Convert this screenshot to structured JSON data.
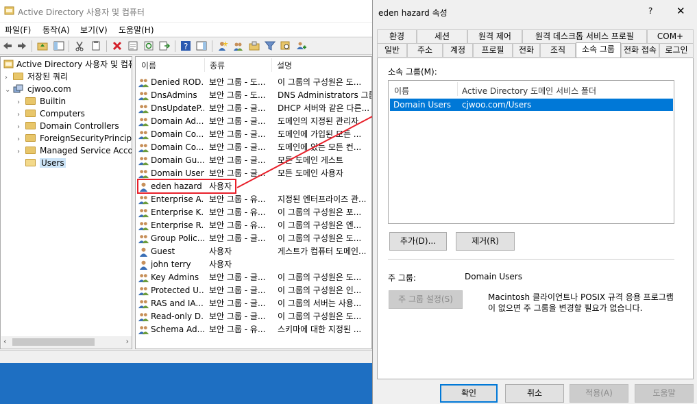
{
  "mmc": {
    "title": "Active Directory 사용자 및 컴퓨터",
    "menu": [
      "파일(F)",
      "동작(A)",
      "보기(V)",
      "도움말(H)"
    ],
    "tree": {
      "root": "Active Directory 사용자 및 컴퓨",
      "saved_queries": "저장된 쿼리",
      "domain": "cjwoo.com",
      "children": [
        "Builtin",
        "Computers",
        "Domain Controllers",
        "ForeignSecurityPrincipal",
        "Managed Service Accou",
        "Users"
      ],
      "selected": "Users"
    },
    "list": {
      "columns": [
        "이름",
        "종류",
        "설명"
      ],
      "rows": [
        {
          "name": "Denied ROD...",
          "type": "보안 그룹 - 도...",
          "desc": "이 그룹의 구성원은 도...",
          "icon": "group-icon"
        },
        {
          "name": "DnsAdmins",
          "type": "보안 그룹 - 도...",
          "desc": "DNS Administrators 그룹",
          "icon": "group-icon"
        },
        {
          "name": "DnsUpdateP...",
          "type": "보안 그룹 - 글...",
          "desc": "DHCP 서버와 같은 다른...",
          "icon": "group-icon"
        },
        {
          "name": "Domain Ad...",
          "type": "보안 그룹 - 글...",
          "desc": "도메인의 지정된 관리자",
          "icon": "group-icon"
        },
        {
          "name": "Domain Co...",
          "type": "보안 그룹 - 글...",
          "desc": "도메인에 가입된 모든 ...",
          "icon": "group-icon"
        },
        {
          "name": "Domain Co...",
          "type": "보안 그룹 - 글...",
          "desc": "도메인에 있는 모든 컨...",
          "icon": "group-icon"
        },
        {
          "name": "Domain Gu...",
          "type": "보안 그룹 - 글...",
          "desc": "모든 도메인 게스트",
          "icon": "group-icon"
        },
        {
          "name": "Domain Users",
          "type": "보안 그룹 - 글...",
          "desc": "모든 도메인 사용자",
          "icon": "group-icon"
        },
        {
          "name": "eden hazard",
          "type": "사용자",
          "desc": "",
          "icon": "user-icon"
        },
        {
          "name": "Enterprise A...",
          "type": "보안 그룹 - 유...",
          "desc": "지정된 엔터프라이즈 관...",
          "icon": "group-icon"
        },
        {
          "name": "Enterprise K...",
          "type": "보안 그룹 - 유...",
          "desc": "이 그룹의 구성원은 포...",
          "icon": "group-icon"
        },
        {
          "name": "Enterprise R...",
          "type": "보안 그룹 - 유...",
          "desc": "이 그룹의 구성원은 엔...",
          "icon": "group-icon"
        },
        {
          "name": "Group Polic...",
          "type": "보안 그룹 - 글...",
          "desc": "이 그룹의 구성원은 도...",
          "icon": "group-icon"
        },
        {
          "name": "Guest",
          "type": "사용자",
          "desc": "게스트가 컴퓨터 도메인...",
          "icon": "user-icon"
        },
        {
          "name": "john terry",
          "type": "사용자",
          "desc": "",
          "icon": "user-icon"
        },
        {
          "name": "Key Admins",
          "type": "보안 그룹 - 글...",
          "desc": "이 그룹의 구성원은 도...",
          "icon": "group-icon"
        },
        {
          "name": "Protected U...",
          "type": "보안 그룹 - 글...",
          "desc": "이 그룹의 구성원은 인...",
          "icon": "group-icon"
        },
        {
          "name": "RAS and IA...",
          "type": "보안 그룹 - 글...",
          "desc": "이 그룹의 서버는 사용...",
          "icon": "group-icon"
        },
        {
          "name": "Read-only D...",
          "type": "보안 그룹 - 글...",
          "desc": "이 그룹의 구성원은 도...",
          "icon": "group-icon"
        },
        {
          "name": "Schema Ad...",
          "type": "보안 그룹 - 유...",
          "desc": "스키마에 대한 지정된 ...",
          "icon": "group-icon"
        }
      ]
    }
  },
  "dialog": {
    "title": "eden hazard 속성",
    "help": "?",
    "close": "✕",
    "tabs_row1": [
      "환경",
      "세션",
      "원격 제어",
      "원격 데스크톱 서비스 프로필",
      "COM+"
    ],
    "tabs_row2": [
      "일반",
      "주소",
      "계정",
      "프로필",
      "전화",
      "조직",
      "소속 그룹",
      "전화 접속",
      "로그인"
    ],
    "active_tab": "소속 그룹",
    "member_of_label": "소속 그룹(M):",
    "member_columns": [
      "이름",
      "Active Directory 도메인 서비스 폴더"
    ],
    "member_rows": [
      {
        "name": "Domain Users",
        "folder": "cjwoo.com/Users"
      }
    ],
    "add_button": "추가(D)...",
    "remove_button": "제거(R)",
    "primary_group_label": "주 그룹:",
    "primary_group_value": "Domain Users",
    "set_primary_button": "주 그룹 설정(S)",
    "primary_note": "Macintosh 클라이언트나 POSIX 규격 응용 프로그램이 없으면 주 그룹을 변경할 필요가 없습니다.",
    "ok_button": "확인",
    "cancel_button": "취소",
    "apply_button": "적용(A)",
    "help_button": "도움말"
  },
  "colors": {
    "highlight": "#e8202a",
    "selection": "#0078d7",
    "desktop": "#1e6fc2"
  }
}
